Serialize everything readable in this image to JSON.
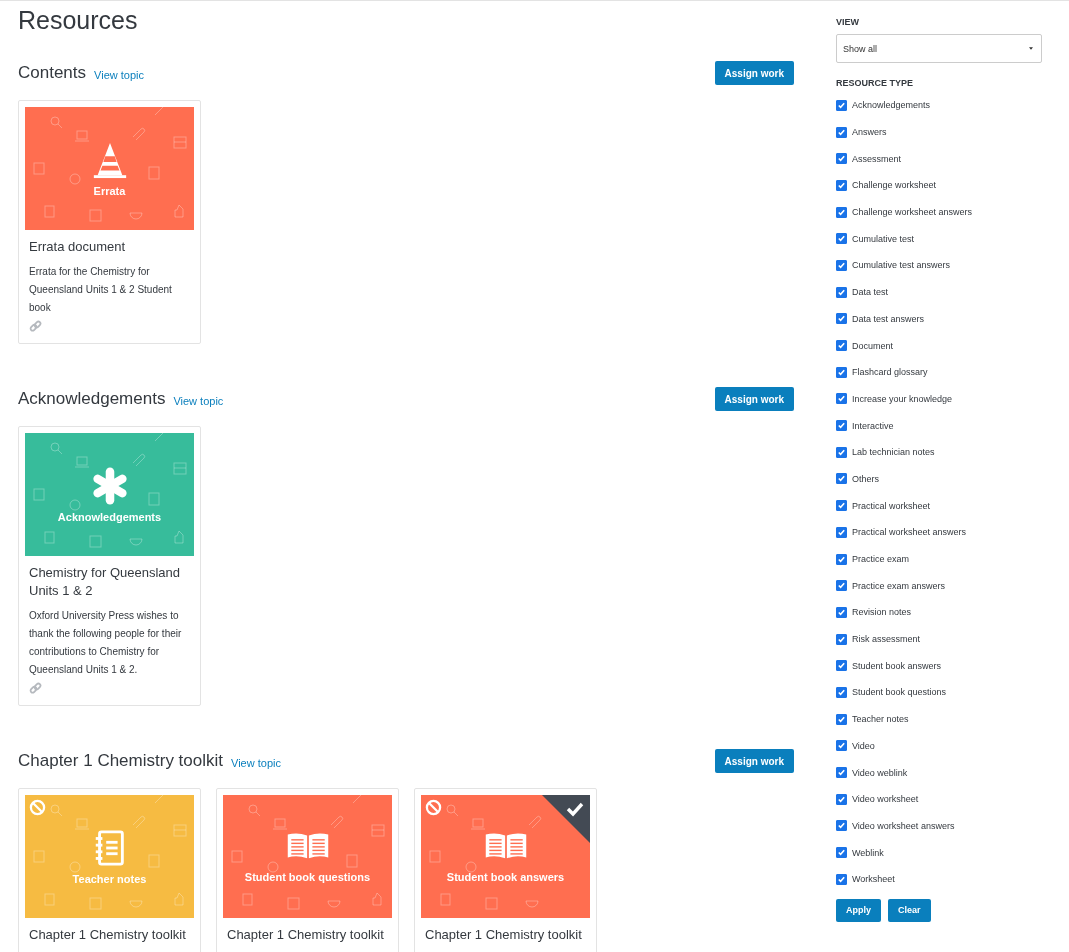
{
  "page_title": "Resources",
  "sections": [
    {
      "heading": "Contents",
      "link": "View topic",
      "button": "Assign work",
      "cards": [
        {
          "color": "#ff6e50",
          "kind": "cone",
          "label": "Errata",
          "blocked": false,
          "selected": false,
          "title": "Errata document",
          "description": "Errata for the Chemistry for Queensland Units 1 & 2 Student book",
          "linked": true
        }
      ]
    },
    {
      "heading": "Acknowledgements",
      "link": "View topic",
      "button": "Assign work",
      "cards": [
        {
          "color": "#37bc9b",
          "kind": "asterisk",
          "label": "Acknowledgements",
          "blocked": false,
          "selected": false,
          "title": "Chemistry for Queensland Units 1 & 2",
          "description": "Oxford University Press wishes to thank the following people for their contributions to Chemistry for Queensland Units 1 & 2.",
          "linked": true
        }
      ]
    },
    {
      "heading": "Chapter 1 Chemistry toolkit",
      "link": "View topic",
      "button": "Assign work",
      "cards": [
        {
          "color": "#f6bb42",
          "kind": "notebook",
          "label": "Teacher notes",
          "blocked": true,
          "selected": false,
          "title": "Chapter 1 Chemistry toolkit",
          "linked": false
        },
        {
          "color": "#ff6e50",
          "kind": "book",
          "label": "Student book questions",
          "blocked": false,
          "selected": false,
          "title": "Chapter 1 Chemistry toolkit",
          "linked": false
        },
        {
          "color": "#ff6e50",
          "kind": "book",
          "label": "Student book answers",
          "blocked": true,
          "selected": true,
          "title": "Chapter 1 Chemistry toolkit",
          "linked": false
        }
      ]
    }
  ],
  "sidebar": {
    "view_label": "VIEW",
    "view_value": "Show all",
    "type_label": "RESOURCE TYPE",
    "types": [
      {
        "label": "Acknowledgements",
        "checked": true
      },
      {
        "label": "Answers",
        "checked": true
      },
      {
        "label": "Assessment",
        "checked": true
      },
      {
        "label": "Challenge worksheet",
        "checked": true
      },
      {
        "label": "Challenge worksheet answers",
        "checked": true
      },
      {
        "label": "Cumulative test",
        "checked": true
      },
      {
        "label": "Cumulative test answers",
        "checked": true
      },
      {
        "label": "Data test",
        "checked": true
      },
      {
        "label": "Data test answers",
        "checked": true
      },
      {
        "label": "Document",
        "checked": true
      },
      {
        "label": "Flashcard glossary",
        "checked": true
      },
      {
        "label": "Increase your knowledge",
        "checked": true
      },
      {
        "label": "Interactive",
        "checked": true
      },
      {
        "label": "Lab technician notes",
        "checked": true
      },
      {
        "label": "Others",
        "checked": true
      },
      {
        "label": "Practical worksheet",
        "checked": true
      },
      {
        "label": "Practical worksheet answers",
        "checked": true
      },
      {
        "label": "Practice exam",
        "checked": true
      },
      {
        "label": "Practice exam answers",
        "checked": true
      },
      {
        "label": "Revision notes",
        "checked": true
      },
      {
        "label": "Risk assessment",
        "checked": true
      },
      {
        "label": "Student book answers",
        "checked": true
      },
      {
        "label": "Student book questions",
        "checked": true
      },
      {
        "label": "Teacher notes",
        "checked": true
      },
      {
        "label": "Video",
        "checked": true
      },
      {
        "label": "Video weblink",
        "checked": true
      },
      {
        "label": "Video worksheet",
        "checked": true
      },
      {
        "label": "Video worksheet answers",
        "checked": true
      },
      {
        "label": "Weblink",
        "checked": true
      },
      {
        "label": "Worksheet",
        "checked": true
      }
    ],
    "buttons": [
      "Apply",
      "Clear"
    ]
  }
}
